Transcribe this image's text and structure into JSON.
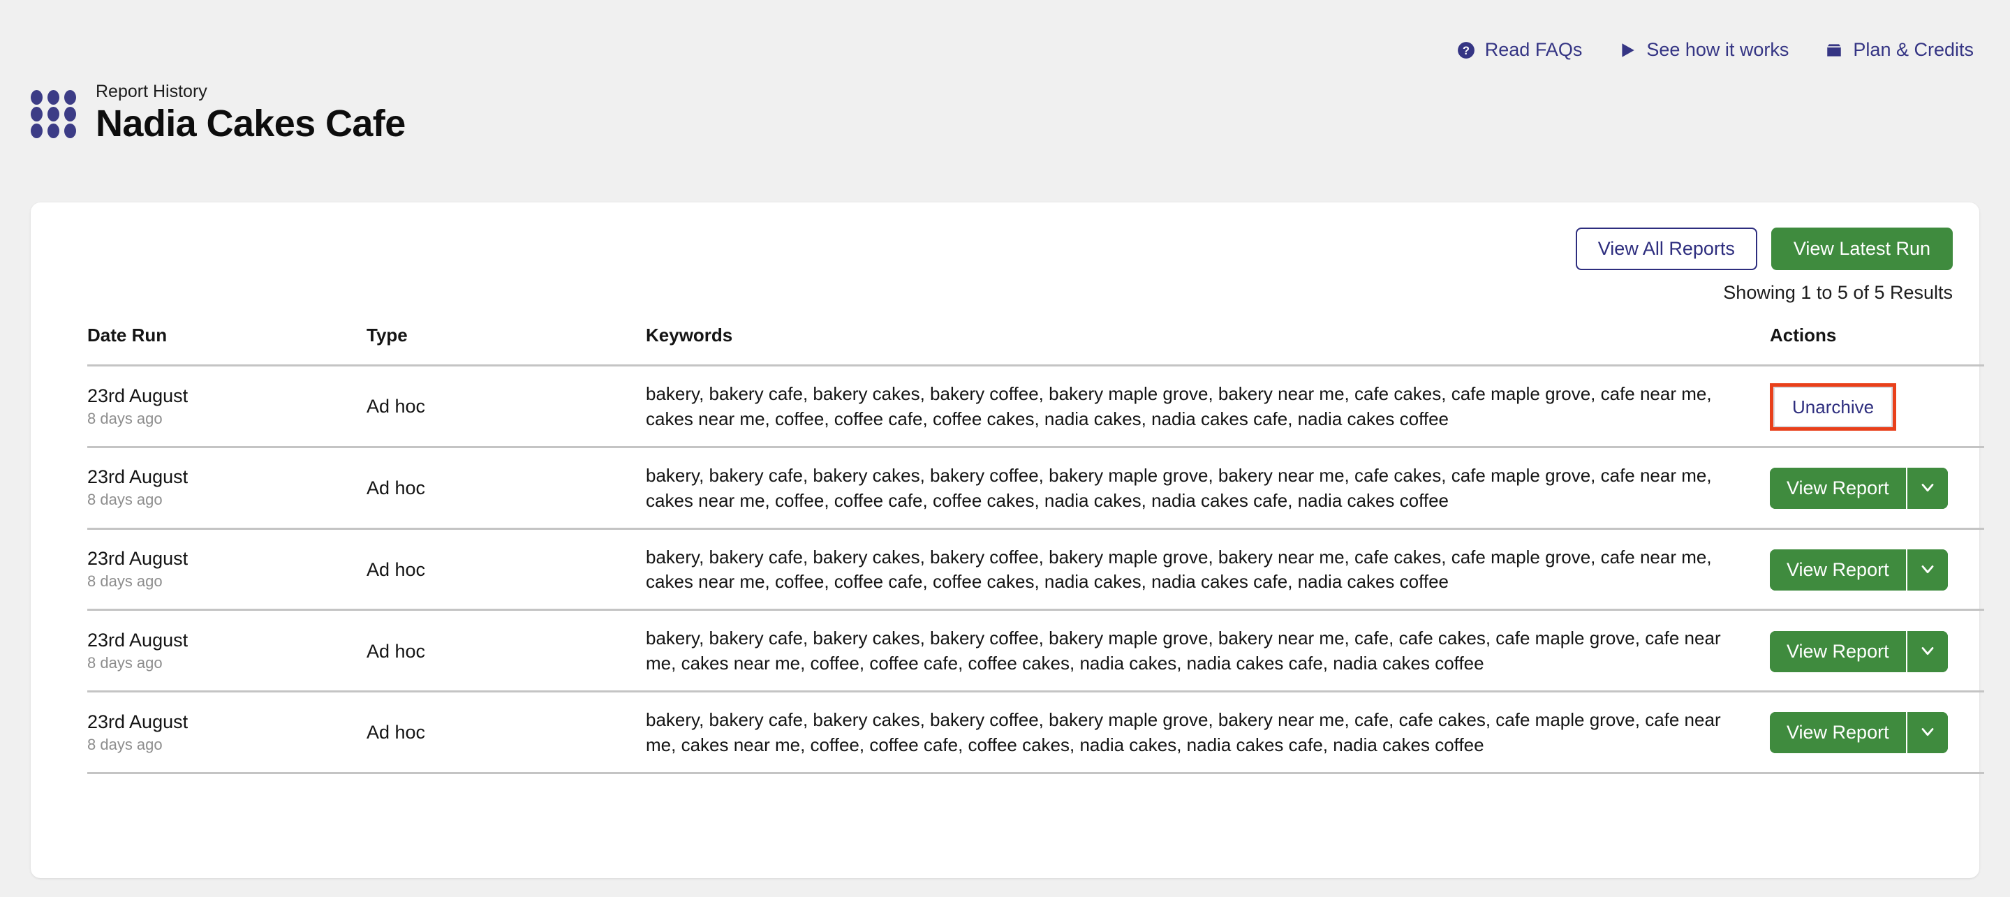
{
  "top_nav": {
    "links": [
      {
        "label": "Read FAQs",
        "icon": "question-circle-icon"
      },
      {
        "label": "See how it works",
        "icon": "play-triangle-icon"
      },
      {
        "label": "Plan & Credits",
        "icon": "package-box-icon"
      }
    ]
  },
  "header": {
    "kicker": "Report History",
    "title": "Nadia Cakes Cafe",
    "logo_icon": "nine-dot-grid-icon"
  },
  "toolbar": {
    "view_all_reports": "View All Reports",
    "view_latest_run": "View Latest Run",
    "results_text": "Showing 1 to 5 of 5 Results"
  },
  "table": {
    "headers": {
      "date": "Date Run",
      "type": "Type",
      "keywords": "Keywords",
      "actions": "Actions"
    },
    "rows": [
      {
        "date": "23rd August",
        "relative": "8 days ago",
        "type": "Ad hoc",
        "keywords": "bakery, bakery cafe, bakery cakes, bakery coffee, bakery maple grove, bakery near me, cafe cakes, cafe maple grove, cafe near me, cakes near me, coffee, coffee cafe, coffee cakes, nadia cakes, nadia cakes cafe, nadia cakes coffee",
        "action": "unarchive",
        "action_label": "Unarchive",
        "highlighted": true
      },
      {
        "date": "23rd August",
        "relative": "8 days ago",
        "type": "Ad hoc",
        "keywords": "bakery, bakery cafe, bakery cakes, bakery coffee, bakery maple grove, bakery near me, cafe cakes, cafe maple grove, cafe near me, cakes near me, coffee, coffee cafe, coffee cakes, nadia cakes, nadia cakes cafe, nadia cakes coffee",
        "action": "view-report",
        "action_label": "View Report",
        "highlighted": false
      },
      {
        "date": "23rd August",
        "relative": "8 days ago",
        "type": "Ad hoc",
        "keywords": "bakery, bakery cafe, bakery cakes, bakery coffee, bakery maple grove, bakery near me, cafe cakes, cafe maple grove, cafe near me, cakes near me, coffee, coffee cafe, coffee cakes, nadia cakes, nadia cakes cafe, nadia cakes coffee",
        "action": "view-report",
        "action_label": "View Report",
        "highlighted": false
      },
      {
        "date": "23rd August",
        "relative": "8 days ago",
        "type": "Ad hoc",
        "keywords": "bakery, bakery cafe, bakery cakes, bakery coffee, bakery maple grove, bakery near me, cafe, cafe cakes, cafe maple grove, cafe near me, cakes near me, coffee, coffee cafe, coffee cakes, nadia cakes, nadia cakes cafe, nadia cakes coffee",
        "action": "view-report",
        "action_label": "View Report",
        "highlighted": false
      },
      {
        "date": "23rd August",
        "relative": "8 days ago",
        "type": "Ad hoc",
        "keywords": "bakery, bakery cafe, bakery cakes, bakery coffee, bakery maple grove, bakery near me, cafe, cafe cakes, cafe maple grove, cafe near me, cakes near me, coffee, coffee cafe, coffee cakes, nadia cakes, nadia cakes cafe, nadia cakes coffee",
        "action": "view-report",
        "action_label": "View Report",
        "highlighted": false
      }
    ]
  },
  "colors": {
    "brand_indigo": "#353584",
    "action_green": "#3f8b3e",
    "highlight_red": "#e8401b",
    "page_bg": "#f0f0f0",
    "card_bg": "#ffffff",
    "muted_text": "#8d8d8d"
  }
}
